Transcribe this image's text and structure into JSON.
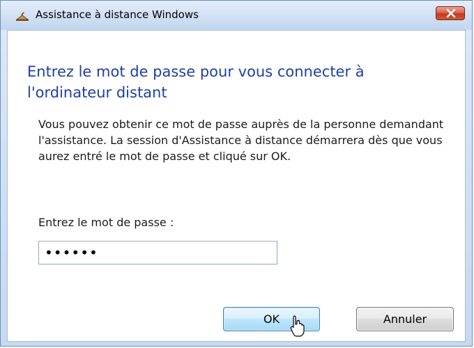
{
  "window": {
    "title": "Assistance à distance Windows",
    "icon": "remote-assistance-icon",
    "close_icon": "close-icon"
  },
  "dialog": {
    "main_instruction": "Entrez le mot de passe pour vous connecter à l'ordinateur distant",
    "description": "Vous pouvez obtenir ce mot de passe auprès de la personne demandant l'assistance. La session d'Assistance à distance démarrera dès que vous aurez entré le mot de passe et cliqué sur OK.",
    "password_label": "Entrez le mot de passe :",
    "password_value": "••••••"
  },
  "buttons": {
    "ok": "OK",
    "cancel": "Annuler"
  },
  "colors": {
    "instruction": "#1f3fa6",
    "close_button": "#c43b1e",
    "ok_border": "#3c7fb1"
  }
}
